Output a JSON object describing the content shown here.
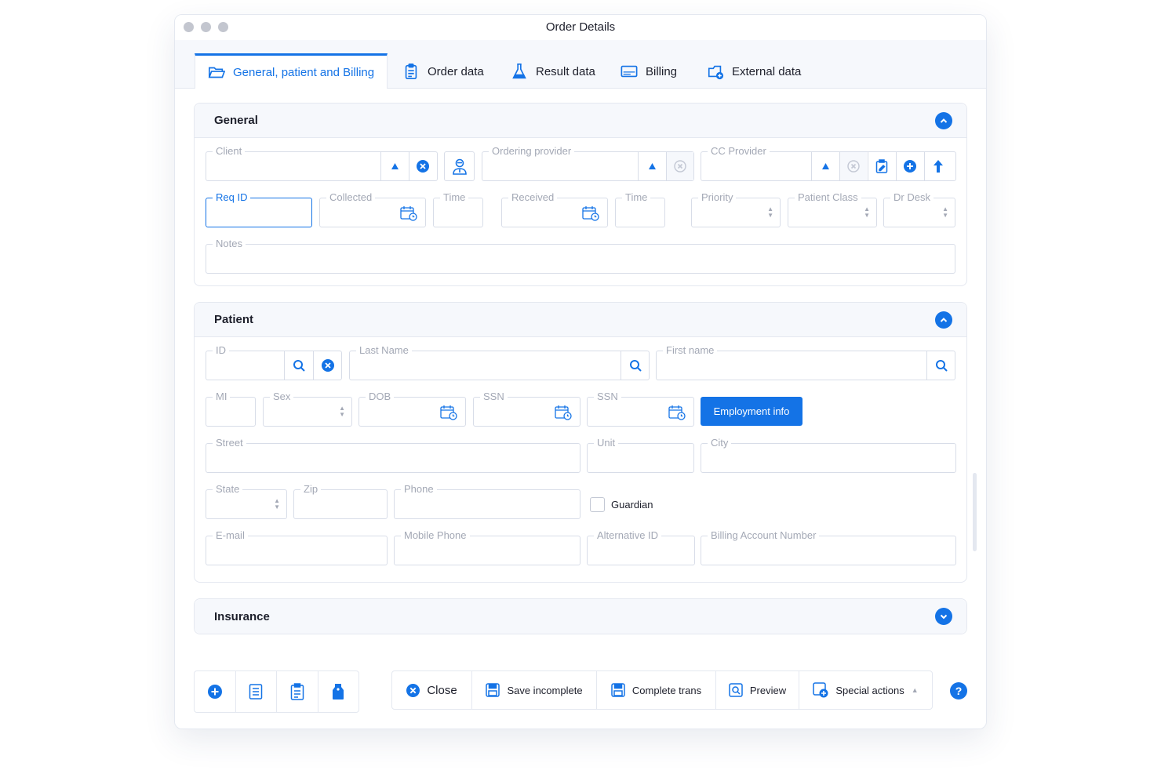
{
  "window": {
    "title": "Order Details"
  },
  "tabs": [
    {
      "label": "General, patient and Billing",
      "icon": "folder-icon"
    },
    {
      "label": "Order data",
      "icon": "clipboard-icon"
    },
    {
      "label": "Result data",
      "icon": "flask-icon"
    },
    {
      "label": "Billing",
      "icon": "card-icon"
    },
    {
      "label": "External data",
      "icon": "cloud-folder-icon"
    }
  ],
  "general": {
    "title": "General",
    "client": {
      "label": "Client",
      "value": ""
    },
    "ordering_provider": {
      "label": "Ordering provider",
      "value": ""
    },
    "cc_provider": {
      "label": "CC Provider",
      "value": ""
    },
    "req_id": {
      "label": "Req ID",
      "value": ""
    },
    "collected": {
      "label": "Collected",
      "value": ""
    },
    "collected_time": {
      "label": "Time",
      "value": ""
    },
    "received": {
      "label": "Received",
      "value": ""
    },
    "received_time": {
      "label": "Time",
      "value": ""
    },
    "priority": {
      "label": "Priority",
      "value": ""
    },
    "patient_class": {
      "label": "Patient Class",
      "value": ""
    },
    "dr_desk": {
      "label": "Dr Desk",
      "value": ""
    },
    "notes": {
      "label": "Notes",
      "value": ""
    }
  },
  "patient": {
    "title": "Patient",
    "id": {
      "label": "ID",
      "value": ""
    },
    "last_name": {
      "label": "Last Name",
      "value": ""
    },
    "first_name": {
      "label": "First name",
      "value": ""
    },
    "mi": {
      "label": "MI",
      "value": ""
    },
    "sex": {
      "label": "Sex",
      "value": ""
    },
    "dob": {
      "label": "DOB",
      "value": ""
    },
    "ssn1": {
      "label": "SSN",
      "value": ""
    },
    "ssn2": {
      "label": "SSN",
      "value": ""
    },
    "employment_button": "Employment info",
    "street": {
      "label": "Street",
      "value": ""
    },
    "unit": {
      "label": "Unit",
      "value": ""
    },
    "city": {
      "label": "City",
      "value": ""
    },
    "state": {
      "label": "State",
      "value": ""
    },
    "zip": {
      "label": "Zip",
      "value": ""
    },
    "phone": {
      "label": "Phone",
      "value": ""
    },
    "guardian": {
      "label": "Guardian",
      "checked": false
    },
    "email": {
      "label": "E-mail",
      "value": ""
    },
    "mobile_phone": {
      "label": "Mobile Phone",
      "value": ""
    },
    "alternative_id": {
      "label": "Alternative ID",
      "value": ""
    },
    "billing_account": {
      "label": "Billing Account Number",
      "value": ""
    }
  },
  "insurance": {
    "title": "Insurance"
  },
  "footer": {
    "close": "Close",
    "save_incomplete": "Save incomplete",
    "complete_trans": "Complete trans",
    "preview": "Preview",
    "special_actions": "Special actions",
    "help": "?"
  },
  "colors": {
    "accent": "#1473e6",
    "border": "#d8dde8",
    "muted": "#a3a8b5",
    "panel": "#f6f8fc"
  }
}
